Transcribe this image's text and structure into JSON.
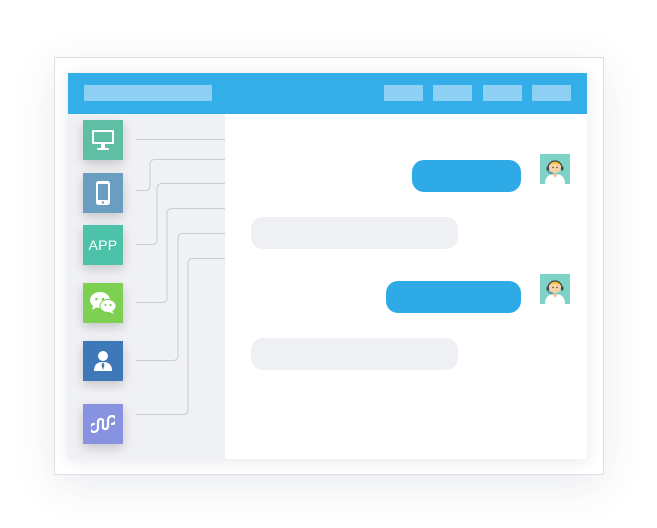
{
  "window": {
    "title_bar": {
      "title": "",
      "nav_items": [
        "",
        "",
        "",
        ""
      ]
    }
  },
  "sidebar": {
    "channels": [
      {
        "name": "desktop-icon",
        "color": "#5fbfa5"
      },
      {
        "name": "mobile-phone-icon",
        "color": "#6a9ec0"
      },
      {
        "name": "app",
        "label": "APP",
        "color": "#4cc2a9"
      },
      {
        "name": "wechat-icon",
        "color": "#7ed052"
      },
      {
        "name": "user-profile-icon",
        "color": "#3e78b8"
      },
      {
        "name": "mini-program-icon",
        "color": "#8792e0"
      }
    ]
  },
  "chat": {
    "messages": [
      {
        "sender": "agent",
        "text": ""
      },
      {
        "sender": "user",
        "text": ""
      },
      {
        "sender": "agent",
        "text": ""
      },
      {
        "sender": "user",
        "text": ""
      }
    ],
    "agent_avatar_icon": "customer-service-agent-icon"
  },
  "colors": {
    "accent": "#33aee8",
    "agent_bubble": "#2eabe6",
    "user_bubble": "#eef0f3",
    "sidebar_bg": "#f0f1f4"
  }
}
